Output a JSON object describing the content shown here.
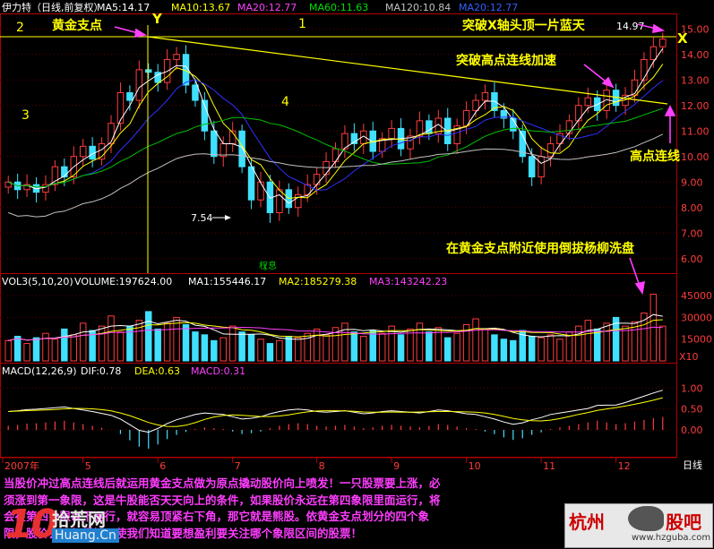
{
  "colors": {
    "background": "#000000",
    "frame": "#b00000",
    "up": "#ff3c3c",
    "down": "#40e0ff",
    "ma5": "#ffffff",
    "ma10": "#ffff00",
    "ma20": "#3030ff",
    "ma60": "#00c000",
    "ma120": "#c0c0c0",
    "annotation": "#ffff00",
    "arrow": "#ff40ff",
    "vol_ma1": "#ffffff",
    "vol_ma2": "#ffff00",
    "vol_ma3": "#ff40ff",
    "caption": "#ff3cff"
  },
  "header": {
    "stock": "伊力特（日线,前复权）",
    "ma5": "MA5:14.17",
    "ma10": "MA10:13.67",
    "ma20": "MA20:12.77",
    "ma60": "MA60:11.63",
    "ma120": "MA120:10.84",
    "ma20b": "MA20:12.77"
  },
  "annotations": {
    "golden_point": "黄金支点",
    "label_Y": "Y",
    "label_X": "X",
    "quadrant_1": "1",
    "quadrant_2": "2",
    "quadrant_3": "3",
    "quadrant_4": "4",
    "breakout_x": "突破X轴头顶一片蓝天",
    "breakout_high": "突破高点连线加速",
    "high_line": "高点连线",
    "washout": "在黄金支点附近使用倒拔杨柳洗盘",
    "low_label": "7.54",
    "high_label": "14.97",
    "weight_mark": "权息"
  },
  "volume_header": {
    "title": "VOL3(5,10,20)",
    "volume": "VOLUME:197624.00",
    "ma1": "MA1:155446.17",
    "ma2": "MA2:185279.38",
    "ma3": "MA3:143242.23"
  },
  "macd_header": {
    "title": "MACD(12,26,9)",
    "dif": "DIF:0.78",
    "dea": "DEA:0.63",
    "macd": "MACD:0.31"
  },
  "time_axis": {
    "year": "2007年",
    "months": [
      "5",
      "6",
      "7",
      "8",
      "9",
      "10",
      "11",
      "12"
    ],
    "unit": "日线"
  },
  "caption": {
    "line1": "当股价冲过高点连线后就运用黄金支点做为原点撬动股价向上喷发！一只股票要上涨，必",
    "line2": "须涨到第一象限，这是牛股能否天天向上的条件，如果股价永远在第四象限里面运行，将",
    "line3": "会在第四象限以下运行，就容易顶紧右下角，那它就是熊股。依黄金支点划分的四个象",
    "line4": "限，股价会运行得好，使我们知道要想盈利要关注哪个象限区间的股票！"
  },
  "logos": {
    "left_num": "10",
    "left_text": "拾荒网",
    "left_url": "Huang.Cn",
    "right_a": "杭州",
    "right_b": "股吧",
    "right_url": "www.hzguba.com"
  },
  "chart_data": [
    {
      "type": "candlestick",
      "title": "伊力特（日线,前复权）",
      "xlabel": "日线",
      "ylim": [
        5.5,
        15.5
      ],
      "yticks": [
        6.0,
        7.0,
        8.0,
        9.0,
        10.0,
        11.0,
        12.0,
        13.0,
        14.0,
        15.0
      ],
      "x_months": [
        "2007年",
        "5",
        "6",
        "7",
        "8",
        "9",
        "10",
        "11",
        "12"
      ],
      "series": [
        {
          "name": "MA5",
          "value": 14.17
        },
        {
          "name": "MA10",
          "value": 13.67
        },
        {
          "name": "MA20",
          "value": 12.77
        },
        {
          "name": "MA60",
          "value": 11.63
        },
        {
          "name": "MA120",
          "value": 10.84
        }
      ],
      "close_path": [
        9.0,
        8.7,
        8.9,
        8.6,
        8.9,
        9.6,
        9.2,
        10.0,
        10.4,
        9.9,
        10.5,
        11.3,
        12.5,
        12.2,
        13.4,
        13.3,
        12.9,
        13.8,
        14.0,
        12.8,
        12.2,
        11.0,
        10.0,
        10.5,
        11.0,
        9.6,
        8.3,
        9.0,
        7.8,
        8.7,
        8.0,
        8.5,
        8.9,
        9.3,
        9.8,
        10.3,
        10.9,
        10.5,
        11.0,
        10.2,
        10.7,
        11.1,
        10.3,
        10.8,
        11.4,
        10.9,
        11.5,
        10.5,
        11.2,
        11.8,
        12.2,
        12.5,
        11.8,
        11.5,
        11.0,
        10.0,
        9.2,
        10.0,
        10.5,
        10.9,
        11.4,
        12.0,
        12.3,
        11.8,
        12.6,
        12.0,
        12.4,
        13.0,
        13.8,
        14.3,
        14.6
      ]
    },
    {
      "type": "bar",
      "title": "VOL3(5,10,20)",
      "ylim": [
        0,
        50000
      ],
      "yticks": [
        15000,
        30000,
        45000
      ],
      "unit_label": "X10",
      "series": [
        {
          "name": "VOLUME",
          "value": 197624.0
        },
        {
          "name": "MA1",
          "value": 155446.17
        },
        {
          "name": "MA2",
          "value": 185279.38
        },
        {
          "name": "MA3",
          "value": 143242.23
        }
      ],
      "values": [
        14000,
        17000,
        12000,
        16000,
        19000,
        15000,
        22000,
        18000,
        26000,
        21000,
        24000,
        31000,
        20000,
        24000,
        28000,
        34000,
        22000,
        26000,
        30000,
        25000,
        20000,
        18000,
        14000,
        16000,
        24000,
        20000,
        18000,
        15000,
        12000,
        14000,
        17000,
        16000,
        19000,
        22000,
        18000,
        23000,
        26000,
        20000,
        17000,
        21000,
        19000,
        24000,
        18000,
        22000,
        26000,
        20000,
        23000,
        16000,
        19000,
        25000,
        29000,
        22000,
        18000,
        15000,
        14000,
        21000,
        17000,
        16000,
        18000,
        15000,
        20000,
        24000,
        28000,
        22000,
        26000,
        30000,
        24000,
        27000,
        33000,
        46000,
        24000
      ]
    },
    {
      "type": "bar",
      "title": "MACD(12,26,9)",
      "ylim": [
        -0.6,
        1.2
      ],
      "yticks": [
        0.0,
        0.5,
        1.0
      ],
      "series": [
        {
          "name": "DIF",
          "value": 0.78
        },
        {
          "name": "DEA",
          "value": 0.63
        },
        {
          "name": "MACD",
          "value": 0.31
        }
      ],
      "values": [
        0.1,
        0.12,
        0.15,
        0.16,
        0.18,
        0.2,
        0.22,
        0.18,
        0.14,
        0.1,
        0.05,
        0.0,
        -0.1,
        -0.25,
        -0.4,
        -0.45,
        -0.35,
        -0.22,
        -0.12,
        -0.05,
        0.02,
        0.06,
        0.04,
        0.02,
        -0.04,
        -0.1,
        -0.08,
        -0.04,
        0.04,
        0.1,
        0.14,
        0.16,
        0.14,
        0.1,
        0.08,
        0.1,
        0.12,
        0.08,
        0.04,
        0.06,
        0.1,
        0.12,
        0.1,
        0.08,
        0.06,
        0.1,
        0.14,
        0.12,
        0.08,
        0.04,
        0.02,
        -0.04,
        -0.1,
        -0.18,
        -0.24,
        -0.2,
        -0.12,
        -0.06,
        0.02,
        0.06,
        0.1,
        0.14,
        0.18,
        0.22,
        0.18,
        0.14,
        0.16,
        0.2,
        0.24,
        0.28,
        0.31
      ]
    }
  ]
}
